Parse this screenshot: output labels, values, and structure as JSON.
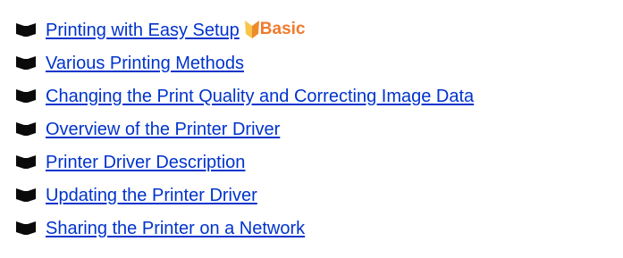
{
  "links": [
    {
      "label": "Printing with Easy Setup",
      "badge": {
        "label": "Basic",
        "icon": "basic-shield-icon"
      }
    },
    {
      "label": "Various Printing Methods"
    },
    {
      "label": "Changing the Print Quality and Correcting Image Data"
    },
    {
      "label": "Overview of the Printer Driver"
    },
    {
      "label": "Printer Driver Description"
    },
    {
      "label": "Updating the Printer Driver"
    },
    {
      "label": "Sharing the Printer on a Network"
    }
  ],
  "colors": {
    "link": "#0033cc",
    "bullet": "#0a0a0a",
    "badge_text": "#f07a2c",
    "badge_icon_light": "#f9c54a",
    "badge_icon_dark": "#ee8a2a"
  },
  "icons": {
    "bullet": "book-bullet-icon"
  }
}
